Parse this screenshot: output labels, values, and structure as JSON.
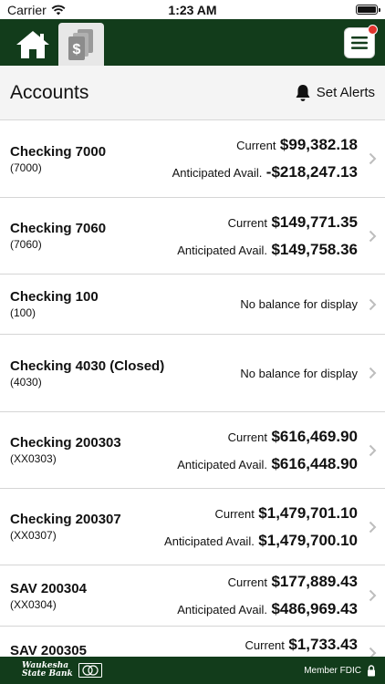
{
  "status": {
    "carrier": "Carrier",
    "time": "1:23 AM"
  },
  "nav": {
    "tabs": [
      {
        "icon": "home-icon"
      },
      {
        "icon": "money-icon"
      }
    ],
    "menu_icon": "hamburger-menu-icon"
  },
  "header": {
    "title": "Accounts",
    "alerts_label": "Set Alerts"
  },
  "accounts": [
    {
      "name": "Checking 7000",
      "number": "(7000)",
      "current_label": "Current",
      "current": "$99,382.18",
      "avail_label": "Anticipated Avail.",
      "avail": "-$218,247.13"
    },
    {
      "name": "Checking 7060",
      "number": "(7060)",
      "current_label": "Current",
      "current": "$149,771.35",
      "avail_label": "Anticipated Avail.",
      "avail": "$149,758.36"
    },
    {
      "name": "Checking 100",
      "number": "(100)",
      "no_balance": "No balance for display"
    },
    {
      "name": "Checking 4030 (Closed)",
      "number": "(4030)",
      "no_balance": "No balance for display"
    },
    {
      "name": "Checking 200303",
      "number": "(XX0303)",
      "current_label": "Current",
      "current": "$616,469.90",
      "avail_label": "Anticipated Avail.",
      "avail": "$616,448.90"
    },
    {
      "name": "Checking 200307",
      "number": "(XX0307)",
      "current_label": "Current",
      "current": "$1,479,701.10",
      "avail_label": "Anticipated Avail.",
      "avail": "$1,479,700.10"
    },
    {
      "name": "SAV 200304",
      "number": "(XX0304)",
      "current_label": "Current",
      "current": "$177,889.43",
      "avail_label": "Anticipated Avail.",
      "avail": "$486,969.43"
    },
    {
      "name": "SAV 200305",
      "number": "",
      "current_label": "Current",
      "current": "$1,733.43"
    }
  ],
  "footer": {
    "logo_line1": "Waukesha",
    "logo_line2": "State Bank",
    "fdic_label": "Member FDIC"
  },
  "colors": {
    "brand_green": "#123c1b",
    "alert_red": "#e0332d"
  }
}
